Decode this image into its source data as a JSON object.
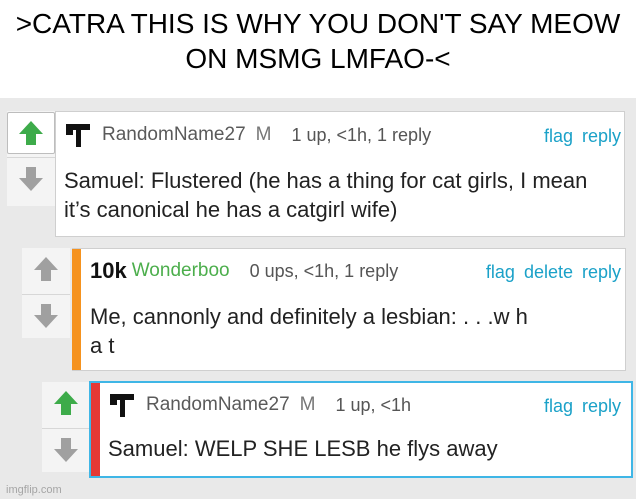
{
  "title": ">CATRA THIS IS WHY YOU DON'T SAY MEOW ON MSMG LMFAO-<",
  "colors": {
    "upvote_active": "#3dab4a",
    "vote_inactive": "#a0a0a0",
    "link": "#1aa1c8",
    "stripe_orange": "#f5921e",
    "stripe_red": "#e53935",
    "highlight_border": "#3fb6e6",
    "username_green": "#4cae4c"
  },
  "comments": [
    {
      "username": "RandomName27",
      "badge": "M",
      "meta": "1 up, <1h, 1 reply",
      "links": [
        "flag",
        "reply"
      ],
      "text": "Samuel: Flustered (he has a thing for cat girls, I mean it’s canonical he has a catgirl wife)",
      "upvoted": true,
      "user_icon": "hammer-icon"
    },
    {
      "badge_prefix": "10k",
      "username": "Wonderboo",
      "meta": "0 ups, <1h, 1 reply",
      "links": [
        "flag",
        "delete",
        "reply"
      ],
      "text": "Me, cannonly and definitely a lesbian: . . .w h a t",
      "upvoted": false
    },
    {
      "username": "RandomName27",
      "badge": "M",
      "meta": "1 up, <1h",
      "links": [
        "flag",
        "reply"
      ],
      "text": "Samuel: WELP SHE LESB he flys away",
      "upvoted": true,
      "user_icon": "hammer-icon"
    }
  ],
  "footer": "imgflip.com"
}
